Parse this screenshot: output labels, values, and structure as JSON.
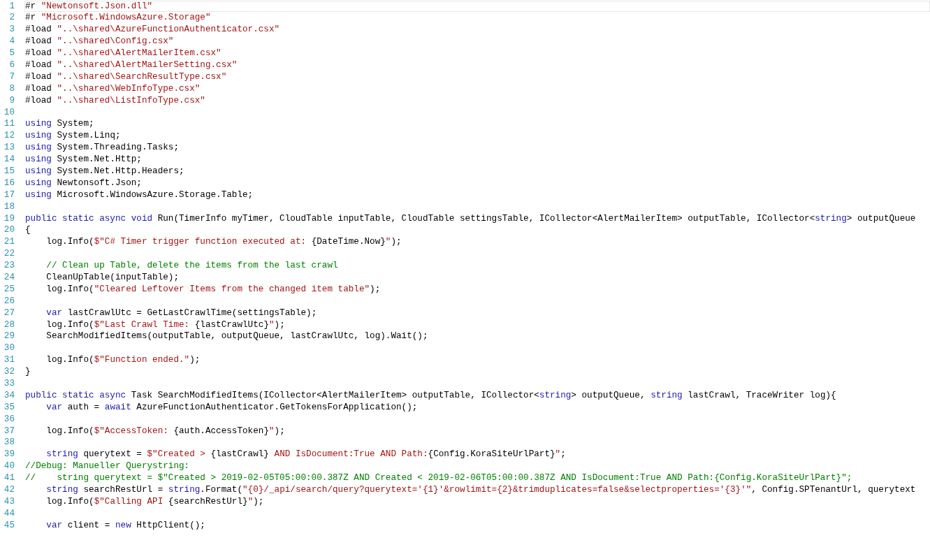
{
  "editor": {
    "lines": [
      {
        "number": "1",
        "current": true,
        "segments": [
          {
            "kind": "plain",
            "text": "#r "
          },
          {
            "kind": "str",
            "text": "\"Newtonsoft.Json.dll\""
          }
        ]
      },
      {
        "number": "2",
        "current": false,
        "segments": [
          {
            "kind": "plain",
            "text": "#r "
          },
          {
            "kind": "str",
            "text": "\"Microsoft.WindowsAzure.Storage\""
          }
        ]
      },
      {
        "number": "3",
        "current": false,
        "segments": [
          {
            "kind": "plain",
            "text": "#load "
          },
          {
            "kind": "str",
            "text": "\"..\\shared\\AzureFunctionAuthenticator.csx\""
          }
        ]
      },
      {
        "number": "4",
        "current": false,
        "segments": [
          {
            "kind": "plain",
            "text": "#load "
          },
          {
            "kind": "str",
            "text": "\"..\\shared\\Config.csx\""
          }
        ]
      },
      {
        "number": "5",
        "current": false,
        "segments": [
          {
            "kind": "plain",
            "text": "#load "
          },
          {
            "kind": "str",
            "text": "\"..\\shared\\AlertMailerItem.csx\""
          }
        ]
      },
      {
        "number": "6",
        "current": false,
        "segments": [
          {
            "kind": "plain",
            "text": "#load "
          },
          {
            "kind": "str",
            "text": "\"..\\shared\\AlertMailerSetting.csx\""
          }
        ]
      },
      {
        "number": "7",
        "current": false,
        "segments": [
          {
            "kind": "plain",
            "text": "#load "
          },
          {
            "kind": "str",
            "text": "\"..\\shared\\SearchResultType.csx\""
          }
        ]
      },
      {
        "number": "8",
        "current": false,
        "segments": [
          {
            "kind": "plain",
            "text": "#load "
          },
          {
            "kind": "str",
            "text": "\"..\\shared\\WebInfoType.csx\""
          }
        ]
      },
      {
        "number": "9",
        "current": false,
        "segments": [
          {
            "kind": "plain",
            "text": "#load "
          },
          {
            "kind": "str",
            "text": "\"..\\shared\\ListInfoType.csx\""
          }
        ]
      },
      {
        "number": "10",
        "current": false
      },
      {
        "number": "11",
        "current": false,
        "segments": [
          {
            "kind": "kw",
            "text": "using"
          },
          {
            "kind": "plain",
            "text": " System;"
          }
        ]
      },
      {
        "number": "12",
        "current": false,
        "segments": [
          {
            "kind": "kw",
            "text": "using"
          },
          {
            "kind": "plain",
            "text": " System.Linq;"
          }
        ]
      },
      {
        "number": "13",
        "current": false,
        "segments": [
          {
            "kind": "kw",
            "text": "using"
          },
          {
            "kind": "plain",
            "text": " System.Threading.Tasks;"
          }
        ]
      },
      {
        "number": "14",
        "current": false,
        "segments": [
          {
            "kind": "kw",
            "text": "using"
          },
          {
            "kind": "plain",
            "text": " System.Net.Http;"
          }
        ]
      },
      {
        "number": "15",
        "current": false,
        "segments": [
          {
            "kind": "kw",
            "text": "using"
          },
          {
            "kind": "plain",
            "text": " System.Net.Http.Headers;"
          }
        ]
      },
      {
        "number": "16",
        "current": false,
        "segments": [
          {
            "kind": "kw",
            "text": "using"
          },
          {
            "kind": "plain",
            "text": " Newtonsoft.Json;"
          }
        ]
      },
      {
        "number": "17",
        "current": false,
        "segments": [
          {
            "kind": "kw",
            "text": "using"
          },
          {
            "kind": "plain",
            "text": " Microsoft.WindowsAzure.Storage.Table;"
          }
        ]
      },
      {
        "number": "18",
        "current": false
      },
      {
        "number": "19",
        "current": false,
        "segments": [
          {
            "kind": "kw",
            "text": "public static async void"
          },
          {
            "kind": "plain",
            "text": " Run(TimerInfo myTimer, CloudTable inputTable, CloudTable settingsTable, ICollector<AlertMailerItem> outputTable, ICollector<"
          },
          {
            "kind": "kw",
            "text": "string"
          },
          {
            "kind": "plain",
            "text": "> outputQueue"
          }
        ]
      },
      {
        "number": "20",
        "current": false,
        "segments": [
          {
            "kind": "plain",
            "text": "{"
          }
        ]
      },
      {
        "number": "21",
        "current": false,
        "segments": [
          {
            "kind": "plain",
            "text": "    log.Info("
          },
          {
            "kind": "str",
            "text": "$\"C# Timer trigger function executed at: "
          },
          {
            "kind": "plain",
            "text": "{DateTime.Now}"
          },
          {
            "kind": "str",
            "text": "\""
          },
          {
            "kind": "plain",
            "text": ");"
          }
        ]
      },
      {
        "number": "22",
        "current": false
      },
      {
        "number": "23",
        "current": false,
        "segments": [
          {
            "kind": "cm",
            "text": "    // Clean up Table, delete the items from the last crawl"
          }
        ]
      },
      {
        "number": "24",
        "current": false,
        "segments": [
          {
            "kind": "plain",
            "text": "    CleanUpTable(inputTable);"
          }
        ]
      },
      {
        "number": "25",
        "current": false,
        "segments": [
          {
            "kind": "plain",
            "text": "    log.Info("
          },
          {
            "kind": "str",
            "text": "\"Cleared Leftover Items from the changed item table\""
          },
          {
            "kind": "plain",
            "text": ");"
          }
        ]
      },
      {
        "number": "26",
        "current": false
      },
      {
        "number": "27",
        "current": false,
        "segments": [
          {
            "kind": "kw",
            "text": "    var"
          },
          {
            "kind": "plain",
            "text": " lastCrawlUtc = GetLastCrawlTime(settingsTable);"
          }
        ]
      },
      {
        "number": "28",
        "current": false,
        "segments": [
          {
            "kind": "plain",
            "text": "    log.Info("
          },
          {
            "kind": "str",
            "text": "$\"Last Crawl Time: "
          },
          {
            "kind": "plain",
            "text": "{lastCrawlUtc}"
          },
          {
            "kind": "str",
            "text": "\""
          },
          {
            "kind": "plain",
            "text": ");"
          }
        ]
      },
      {
        "number": "29",
        "current": false,
        "segments": [
          {
            "kind": "plain",
            "text": "    SearchModifiedItems(outputTable, outputQueue, lastCrawlUtc, log).Wait();"
          }
        ]
      },
      {
        "number": "30",
        "current": false
      },
      {
        "number": "31",
        "current": false,
        "segments": [
          {
            "kind": "plain",
            "text": "    log.Info("
          },
          {
            "kind": "str",
            "text": "$\"Function ended.\""
          },
          {
            "kind": "plain",
            "text": ");"
          }
        ]
      },
      {
        "number": "32",
        "current": false,
        "segments": [
          {
            "kind": "plain",
            "text": "}"
          }
        ]
      },
      {
        "number": "33",
        "current": false
      },
      {
        "number": "34",
        "current": false,
        "segments": [
          {
            "kind": "kw",
            "text": "public static async"
          },
          {
            "kind": "plain",
            "text": " Task SearchModifiedItems(ICollector<AlertMailerItem> outputTable, ICollector<"
          },
          {
            "kind": "kw",
            "text": "string"
          },
          {
            "kind": "plain",
            "text": "> outputQueue, "
          },
          {
            "kind": "kw",
            "text": "string"
          },
          {
            "kind": "plain",
            "text": " lastCrawl, TraceWriter log){"
          }
        ]
      },
      {
        "number": "35",
        "current": false,
        "segments": [
          {
            "kind": "kw",
            "text": "    var"
          },
          {
            "kind": "plain",
            "text": " auth = "
          },
          {
            "kind": "kw",
            "text": "await"
          },
          {
            "kind": "plain",
            "text": " AzureFunctionAuthenticator.GetTokensForApplication();"
          }
        ]
      },
      {
        "number": "36",
        "current": false
      },
      {
        "number": "37",
        "current": false,
        "segments": [
          {
            "kind": "plain",
            "text": "    log.Info("
          },
          {
            "kind": "str",
            "text": "$\"AccessToken: "
          },
          {
            "kind": "plain",
            "text": "{auth.AccessToken}"
          },
          {
            "kind": "str",
            "text": "\""
          },
          {
            "kind": "plain",
            "text": ");"
          }
        ]
      },
      {
        "number": "38",
        "current": false
      },
      {
        "number": "39",
        "current": false,
        "segments": [
          {
            "kind": "kw",
            "text": "    string"
          },
          {
            "kind": "plain",
            "text": " querytext = "
          },
          {
            "kind": "str",
            "text": "$\"Created > "
          },
          {
            "kind": "plain",
            "text": "{lastCrawl}"
          },
          {
            "kind": "str",
            "text": " AND IsDocument:True AND Path:"
          },
          {
            "kind": "plain",
            "text": "{Config.KoraSiteUrlPart}"
          },
          {
            "kind": "str",
            "text": "\""
          },
          {
            "kind": "plain",
            "text": ";"
          }
        ]
      },
      {
        "number": "40",
        "current": false,
        "segments": [
          {
            "kind": "cm",
            "text": "//Debug: Manueller Querystring:"
          }
        ]
      },
      {
        "number": "41",
        "current": false,
        "segments": [
          {
            "kind": "cm",
            "text": "//    string querytext = $\"Created > 2019-02-05T05:00:00.387Z AND Created < 2019-02-06T05:00:00.387Z AND IsDocument:True AND Path:{Config.KoraSiteUrlPart}\";"
          }
        ]
      },
      {
        "number": "42",
        "current": false,
        "segments": [
          {
            "kind": "kw",
            "text": "    string"
          },
          {
            "kind": "plain",
            "text": " searchRestUrl = "
          },
          {
            "kind": "kw",
            "text": "string"
          },
          {
            "kind": "plain",
            "text": ".Format("
          },
          {
            "kind": "str",
            "text": "\"{0}/_api/search/query?querytext='{1}'&rowlimit={2}&trimduplicates=false&selectproperties='{3}'\""
          },
          {
            "kind": "plain",
            "text": ", Config.SPTenantUrl, querytext"
          }
        ]
      },
      {
        "number": "43",
        "current": false,
        "segments": [
          {
            "kind": "plain",
            "text": "    log.Info("
          },
          {
            "kind": "str",
            "text": "$\"Calling API "
          },
          {
            "kind": "plain",
            "text": "{searchRestUrl}"
          },
          {
            "kind": "str",
            "text": "\""
          },
          {
            "kind": "plain",
            "text": ");"
          }
        ]
      },
      {
        "number": "44",
        "current": false
      },
      {
        "number": "45",
        "current": false,
        "segments": [
          {
            "kind": "kw",
            "text": "    var"
          },
          {
            "kind": "plain",
            "text": " client = "
          },
          {
            "kind": "kw",
            "text": "new"
          },
          {
            "kind": "plain",
            "text": " HttpClient();"
          }
        ]
      }
    ]
  }
}
